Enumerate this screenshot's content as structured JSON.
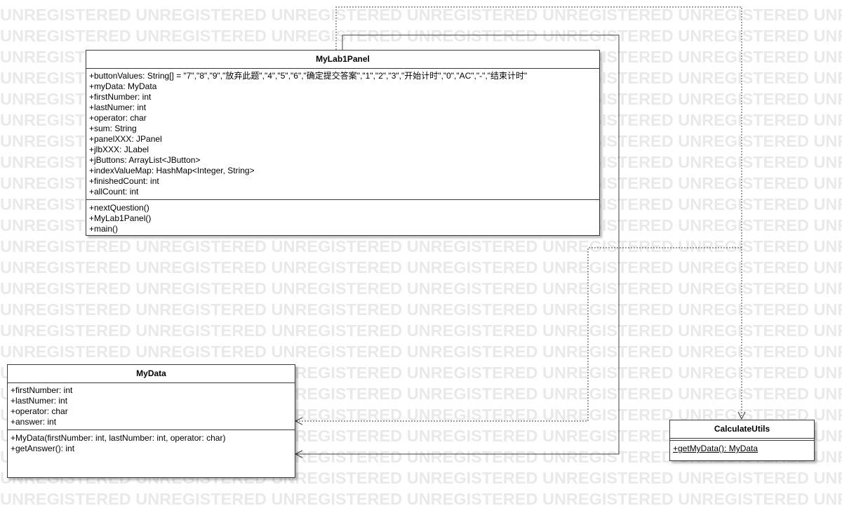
{
  "watermark": {
    "text": "UNREGISTERED UNREGISTERED UNREGISTERED UNREGISTERED UNREGISTERED UNREGISTERED UNREGISTERED UNREGISTERED"
  },
  "classes": {
    "mylab1panel": {
      "name": "MyLab1Panel",
      "attributes": [
        "+buttonValues: String[] = \"7\",\"8\",\"9\",\"放弃此题\",\"4\",\"5\",\"6\",\"确定提交答案\",\"1\",\"2\",\"3\",\"开始计时\",\"0\",\"AC\",\"-\",\"结束计时\"",
        "+myData: MyData",
        "+firstNumber: int",
        "+lastNumer: int",
        "+operator: char",
        "+sum: String",
        "+panelXXX: JPanel",
        "+jlbXXX: JLabel",
        "+jButtons: ArrayList<JButton>",
        "+indexValueMap: HashMap<Integer, String>",
        "+finishedCount: int",
        "+allCount: int"
      ],
      "operations": [
        "+nextQuestion()",
        "+MyLab1Panel()",
        "+main()"
      ]
    },
    "mydata": {
      "name": "MyData",
      "attributes": [
        "+firstNumber: int",
        "+lastNumer: int",
        "+operator: char",
        "+answer: int"
      ],
      "operations": [
        "+MyData(firstNumber: int, lastNumber: int, operator: char)",
        "+getAnswer(): int"
      ]
    },
    "calculateutils": {
      "name": "CalculateUtils",
      "attributes": [],
      "operations": [
        "+getMyData(): MyData"
      ]
    }
  },
  "relations": [
    {
      "from": "MyLab1Panel",
      "to": "MyData",
      "kind": "association"
    },
    {
      "from": "MyLab1Panel",
      "to": "CalculateUtils",
      "kind": "dependency"
    },
    {
      "from": "CalculateUtils",
      "to": "MyData",
      "kind": "dependency"
    }
  ]
}
